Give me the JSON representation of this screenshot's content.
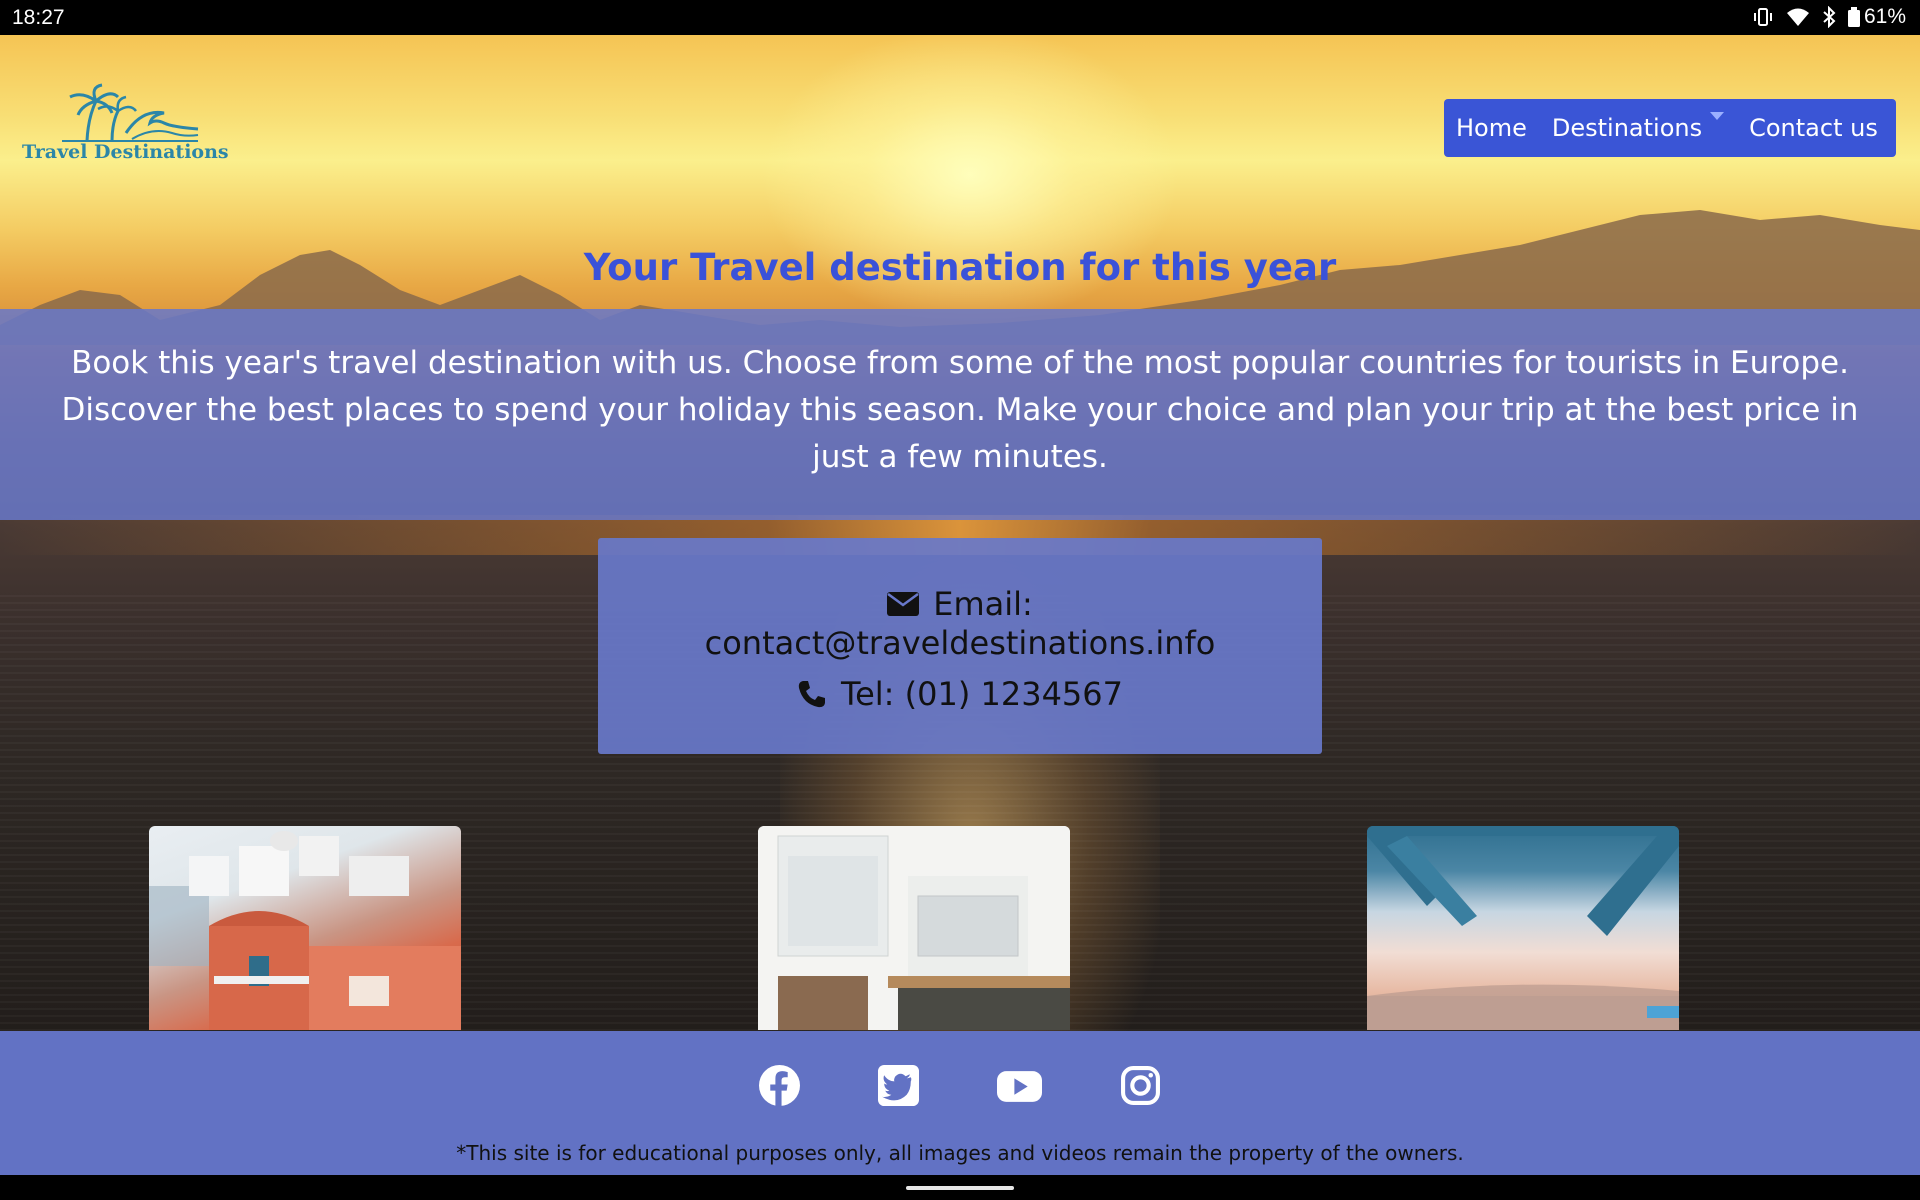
{
  "status_bar": {
    "time": "18:27",
    "battery": "61%"
  },
  "logo": {
    "text": "Travel Destinations"
  },
  "nav": {
    "items": [
      {
        "label": "Home"
      },
      {
        "label": "Destinations"
      },
      {
        "label": "Contact us"
      }
    ]
  },
  "hero": {
    "title": "Your Travel destination for this year",
    "intro": "Book this year's travel destination with us. Choose from some of the most popular countries for tourists in Europe. Discover the best places to spend your holiday this season. Make your choice and plan your trip at the best price in just a few minutes."
  },
  "contact": {
    "email_label": "Email:",
    "email": "contact@traveldestinations.info",
    "tel": "Tel: (01) 1234567"
  },
  "footer": {
    "social_icons": [
      "facebook-icon",
      "twitter-icon",
      "youtube-icon",
      "instagram-icon"
    ],
    "disclaimer": "*This site is for educational purposes only, all images and videos remain the property of the owners."
  },
  "colors": {
    "nav_bg": "#3a55d6",
    "title": "#3a52d9",
    "band": "#6878ca",
    "footer": "#6272c4",
    "logo": "#2b86a8"
  }
}
